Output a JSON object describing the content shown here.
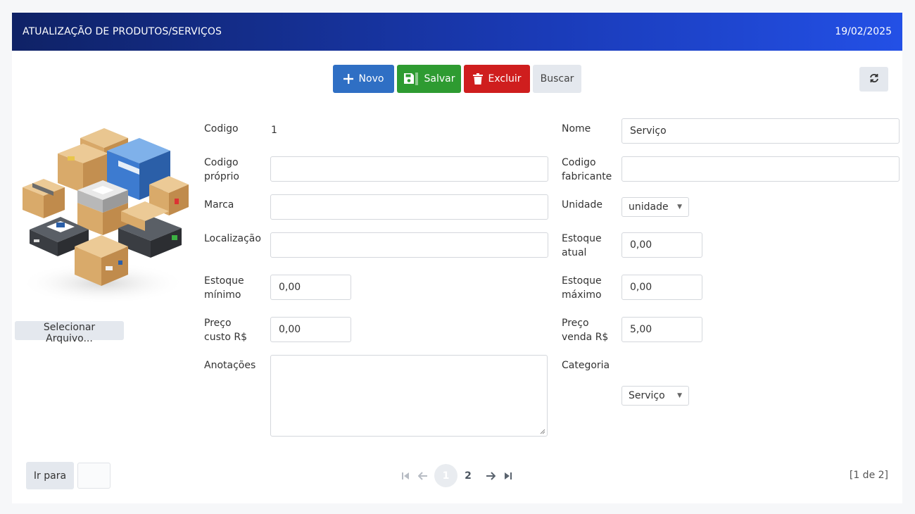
{
  "header": {
    "title": "ATUALIZAÇÃO DE PRODUTOS/SERVIÇOS",
    "date": "19/02/2025"
  },
  "toolbar": {
    "novo_label": "Novo",
    "salvar_label": "Salvar",
    "excluir_label": "Excluir",
    "buscar_label": "Buscar"
  },
  "image_panel": {
    "file_button_label": "Selecionar Arquivo..."
  },
  "form": {
    "codigo": {
      "label": "Codigo",
      "value": "1"
    },
    "nome": {
      "label": "Nome",
      "value": "Serviço"
    },
    "codigo_proprio": {
      "label_line1": "Codigo",
      "label_line2": "próprio",
      "value": ""
    },
    "codigo_fabricante": {
      "label_line1": "Codigo",
      "label_line2": "fabricante",
      "value": ""
    },
    "marca": {
      "label": "Marca",
      "value": ""
    },
    "unidade": {
      "label": "Unidade",
      "value": "unidade"
    },
    "localizacao": {
      "label": "Localização",
      "value": ""
    },
    "estoque_atual": {
      "label_line1": "Estoque",
      "label_line2": "atual",
      "value": "0,00"
    },
    "estoque_minimo": {
      "label_line1": "Estoque",
      "label_line2": "mínimo",
      "value": "0,00"
    },
    "estoque_maximo": {
      "label_line1": "Estoque",
      "label_line2": "máximo",
      "value": "0,00"
    },
    "preco_custo": {
      "label_line1": "Preço",
      "label_line2": "custo R$",
      "value": "0,00"
    },
    "preco_venda": {
      "label_line1": "Preço",
      "label_line2": "venda R$",
      "value": "5,00"
    },
    "anotacoes": {
      "label": "Anotações",
      "value": ""
    },
    "categoria": {
      "label": "Categoria",
      "value": "Serviço"
    }
  },
  "footer": {
    "goto_label": "Ir para",
    "goto_value": "",
    "pages": [
      "1",
      "2"
    ],
    "current_page": "1",
    "page_info": "[1 de 2]"
  },
  "colors": {
    "header_gradient_start": "#0f2266",
    "header_gradient_end": "#2350e6",
    "novo": "#2f6fc4",
    "salvar": "#2e9b31",
    "excluir": "#cf1e1e",
    "neutral_button": "#e4e8ee"
  },
  "icons": {
    "novo": "plus-icon",
    "salvar": "floppy-disk-icon",
    "excluir": "trash-icon",
    "refresh": "refresh-icon",
    "first": "first-page-icon",
    "prev": "arrow-left-icon",
    "next": "arrow-right-icon",
    "last": "last-page-icon"
  }
}
